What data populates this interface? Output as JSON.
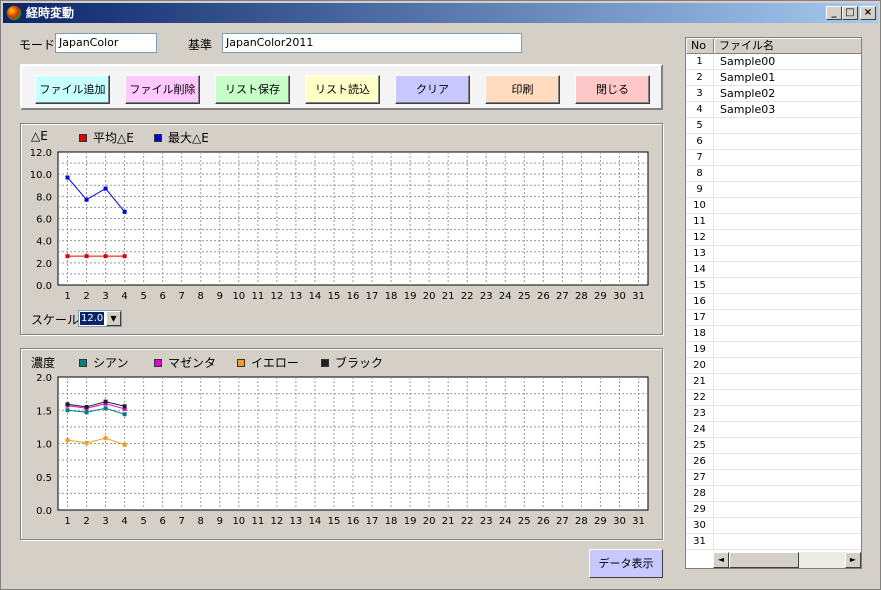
{
  "window": {
    "title": "経時変動",
    "controls": {
      "minimize": "_",
      "maximize": "□",
      "close": "×"
    }
  },
  "header": {
    "mode_label": "モード",
    "mode_value": "JapanColor",
    "standard_label": "基準",
    "standard_value": "JapanColor2011"
  },
  "toolbar": {
    "buttons": [
      {
        "label": "ファイル追加",
        "color": "#c8ffff"
      },
      {
        "label": "ファイル削除",
        "color": "#ffc8ff"
      },
      {
        "label": "リスト保存",
        "color": "#c8ffc8"
      },
      {
        "label": "リスト読込",
        "color": "#ffffc8"
      },
      {
        "label": "クリア",
        "color": "#c8c8ff"
      },
      {
        "label": "印刷",
        "color": "#ffdcc0"
      },
      {
        "label": "閉じる",
        "color": "#ffc8c8"
      }
    ]
  },
  "delta_chart": {
    "legend_title": "△E",
    "scale_label": "スケール",
    "scale_value": "12.0",
    "chart_data": {
      "type": "line",
      "title": "",
      "x": [
        1,
        2,
        3,
        4,
        5,
        6,
        7,
        8,
        9,
        10,
        11,
        12,
        13,
        14,
        15,
        16,
        17,
        18,
        19,
        20,
        21,
        22,
        23,
        24,
        25,
        26,
        27,
        28,
        29,
        30,
        31
      ],
      "ylim": [
        0,
        12
      ],
      "yticks": [
        "0.0",
        "2.0",
        "4.0",
        "6.0",
        "8.0",
        "10.0",
        "12.0"
      ],
      "grid": true,
      "series": [
        {
          "name": "平均△E",
          "color": "#e00000",
          "values": [
            2.6,
            2.6,
            2.6,
            2.6
          ]
        },
        {
          "name": "最大△E",
          "color": "#0000e0",
          "values": [
            9.7,
            7.7,
            8.7,
            6.6
          ]
        }
      ]
    }
  },
  "density_chart": {
    "legend_title": "濃度",
    "chart_data": {
      "type": "line",
      "title": "",
      "x": [
        1,
        2,
        3,
        4,
        5,
        6,
        7,
        8,
        9,
        10,
        11,
        12,
        13,
        14,
        15,
        16,
        17,
        18,
        19,
        20,
        21,
        22,
        23,
        24,
        25,
        26,
        27,
        28,
        29,
        30,
        31
      ],
      "ylim": [
        0,
        2
      ],
      "yticks": [
        "0.0",
        "0.5",
        "1.0",
        "1.5",
        "2.0"
      ],
      "grid": true,
      "series": [
        {
          "name": "シアン",
          "color": "#008080",
          "values": [
            1.5,
            1.47,
            1.53,
            1.44
          ]
        },
        {
          "name": "マゼンタ",
          "color": "#e000e0",
          "values": [
            1.57,
            1.53,
            1.6,
            1.52
          ]
        },
        {
          "name": "イエロー",
          "color": "#f0a020",
          "values": [
            1.05,
            1.01,
            1.08,
            0.98
          ]
        },
        {
          "name": "ブラック",
          "color": "#202020",
          "values": [
            1.59,
            1.55,
            1.63,
            1.56
          ]
        }
      ]
    }
  },
  "data_button": {
    "label": "データ表示"
  },
  "file_list": {
    "col_no": "No",
    "col_name": "ファイル名",
    "rows": [
      {
        "no": "1",
        "name": "Sample00"
      },
      {
        "no": "2",
        "name": "Sample01"
      },
      {
        "no": "3",
        "name": "Sample02"
      },
      {
        "no": "4",
        "name": "Sample03"
      },
      {
        "no": "5",
        "name": ""
      },
      {
        "no": "6",
        "name": ""
      },
      {
        "no": "7",
        "name": ""
      },
      {
        "no": "8",
        "name": ""
      },
      {
        "no": "9",
        "name": ""
      },
      {
        "no": "10",
        "name": ""
      },
      {
        "no": "11",
        "name": ""
      },
      {
        "no": "12",
        "name": ""
      },
      {
        "no": "13",
        "name": ""
      },
      {
        "no": "14",
        "name": ""
      },
      {
        "no": "15",
        "name": ""
      },
      {
        "no": "16",
        "name": ""
      },
      {
        "no": "17",
        "name": ""
      },
      {
        "no": "18",
        "name": ""
      },
      {
        "no": "19",
        "name": ""
      },
      {
        "no": "20",
        "name": ""
      },
      {
        "no": "21",
        "name": ""
      },
      {
        "no": "22",
        "name": ""
      },
      {
        "no": "23",
        "name": ""
      },
      {
        "no": "24",
        "name": ""
      },
      {
        "no": "25",
        "name": ""
      },
      {
        "no": "26",
        "name": ""
      },
      {
        "no": "27",
        "name": ""
      },
      {
        "no": "28",
        "name": ""
      },
      {
        "no": "29",
        "name": ""
      },
      {
        "no": "30",
        "name": ""
      },
      {
        "no": "31",
        "name": ""
      }
    ],
    "scroll_left": "◄",
    "scroll_right": "►"
  }
}
